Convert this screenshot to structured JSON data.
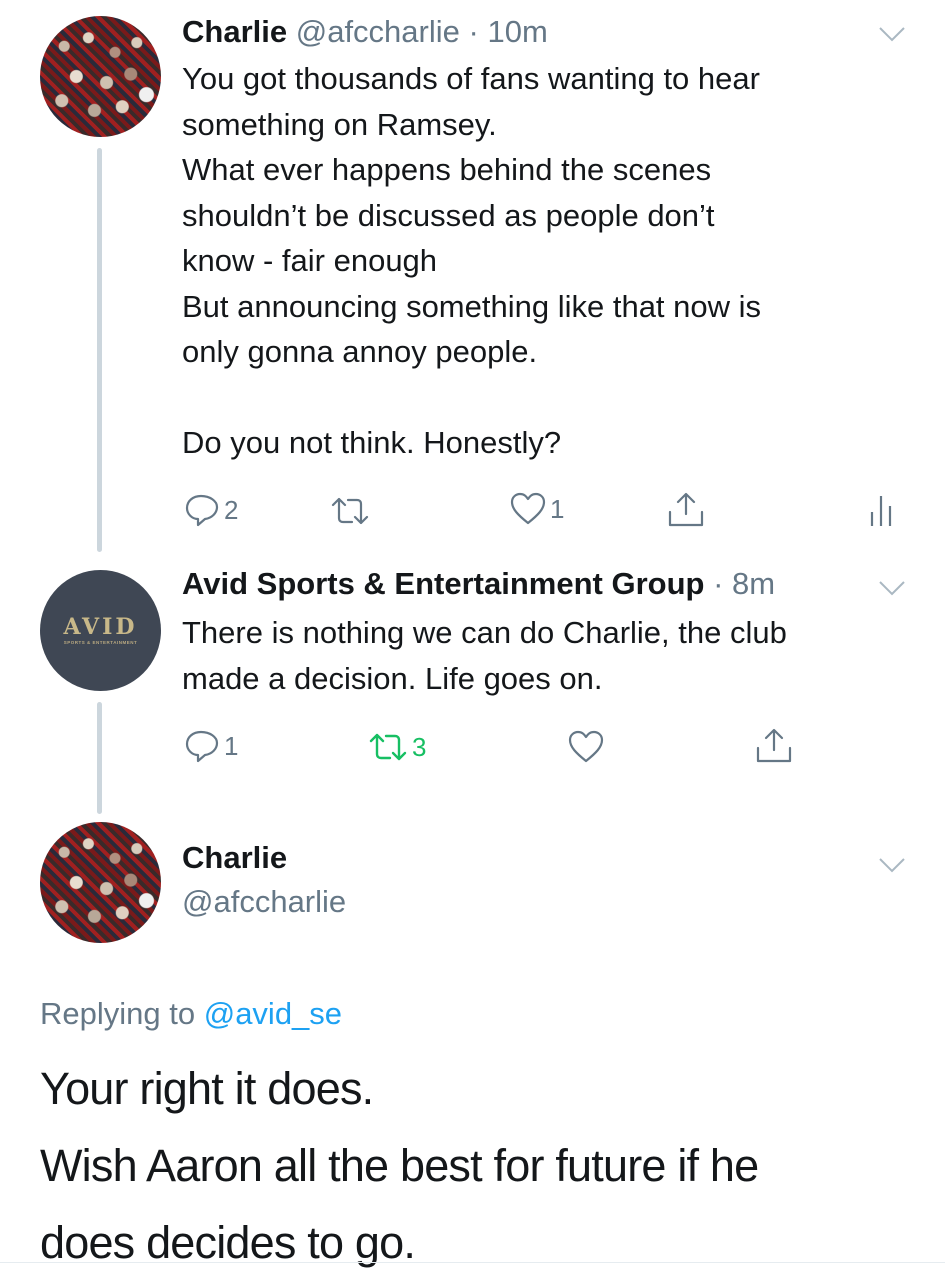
{
  "tweets": [
    {
      "name": "Charlie",
      "handle": "@afccharlie",
      "dot": "·",
      "time": "10m",
      "text": "You got thousands of fans wanting to hear\nsomething on Ramsey.\nWhat ever happens behind the scenes\nshouldn’t be discussed as people don’t\nknow - fair enough\nBut announcing something like that now is\nonly gonna annoy people.\n\nDo you not think. Honestly?",
      "replies": "2",
      "retweets": "",
      "likes": "1"
    },
    {
      "name": "Avid Sports & Entertainment Group",
      "dot": "·",
      "time": "8m",
      "text": "There is nothing we can do Charlie, the club\nmade a decision. Life goes on.",
      "replies": "1",
      "retweets": "3",
      "likes": "",
      "avatar_logo": "AVID",
      "avatar_sub": "SPORTS & ENTERTAINMENT"
    }
  ],
  "focused": {
    "name": "Charlie",
    "handle": "@afccharlie",
    "replying_prefix": "Replying to",
    "replying_to": "@avid_se",
    "text": "Your right it does.\nWish Aaron all the best for future if he\ndoes decides to go."
  },
  "colors": {
    "text": "#14171a",
    "secondary": "#657786",
    "link": "#1da1f2",
    "retweet_active": "#17bf63",
    "thread_line": "#ccd6dd"
  }
}
